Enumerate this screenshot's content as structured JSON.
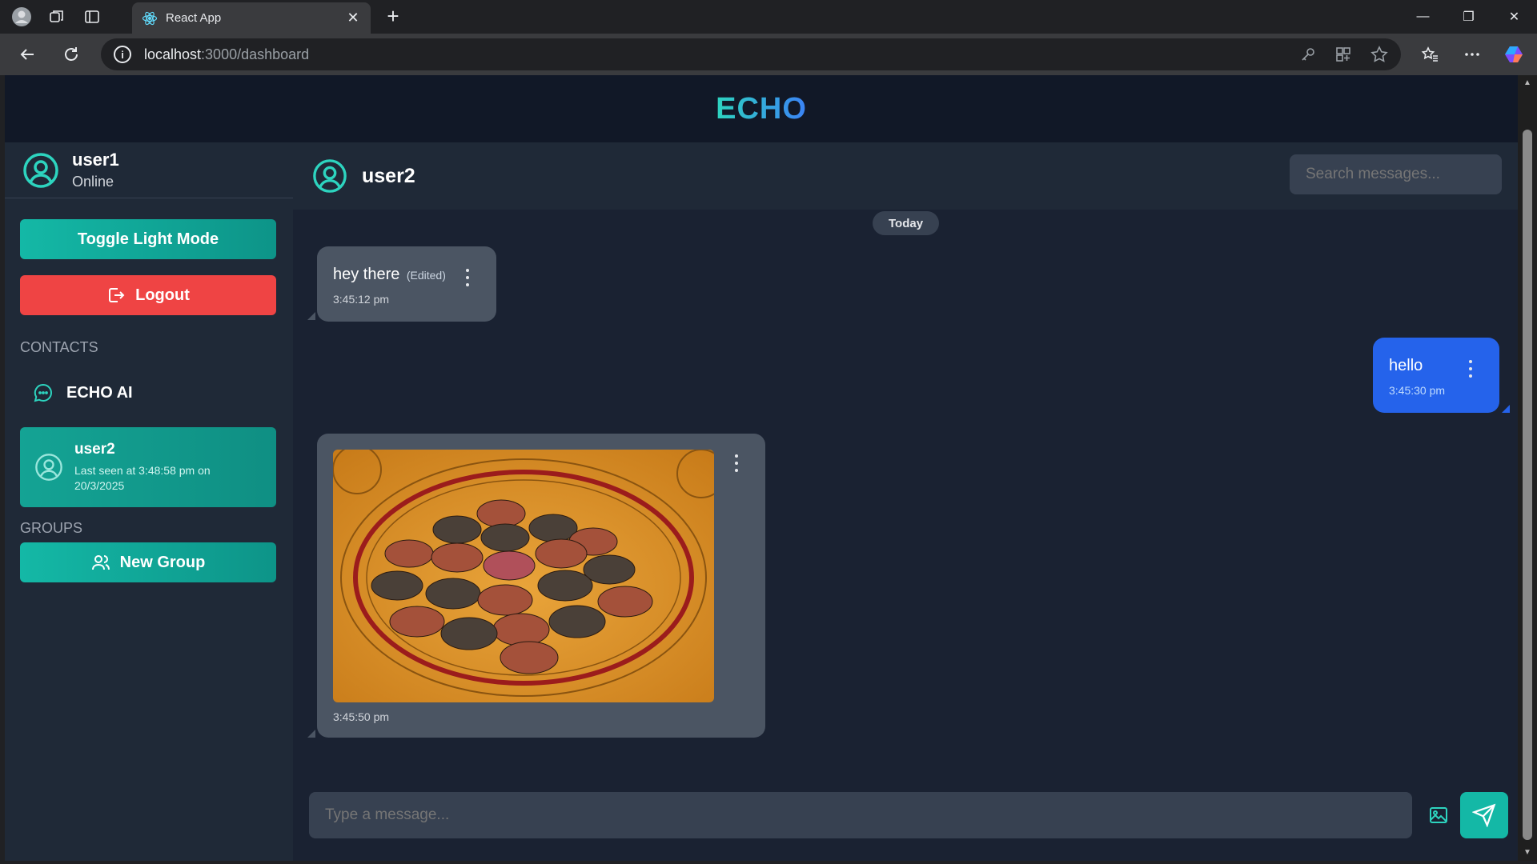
{
  "browser": {
    "tab_title": "React App",
    "tab_close": "✕",
    "new_tab": "+",
    "url_host": "localhost",
    "url_path": ":3000/dashboard",
    "info_icon_label": "i",
    "win_minimize": "—",
    "win_restore": "❐",
    "win_close": "✕"
  },
  "app": {
    "title": "ECHO"
  },
  "sidebar": {
    "user_name": "user1",
    "user_status": "Online",
    "toggle_label": "Toggle Light Mode",
    "logout_label": "Logout",
    "contacts_heading": "CONTACTS",
    "contacts": [
      {
        "name": "ECHO AI"
      },
      {
        "name": "user2",
        "last_seen": "Last seen at 3:48:58 pm on 20/3/2025"
      }
    ],
    "groups_heading": "GROUPS",
    "new_group_label": "New Group"
  },
  "chat": {
    "contact_name": "user2",
    "search_placeholder": "Search messages...",
    "date_divider": "Today",
    "messages": [
      {
        "direction": "in",
        "text": "hey there",
        "edited": "(Edited)",
        "time": "3:45:12 pm"
      },
      {
        "direction": "out",
        "text": "hello",
        "time": "3:45:30 pm"
      },
      {
        "direction": "in",
        "type": "image",
        "time": "3:45:50 pm"
      }
    ],
    "composer_placeholder": "Type a message..."
  },
  "colors": {
    "accent": "#14b8a6",
    "danger": "#ef4444",
    "outgoing": "#2563eb",
    "incoming": "#4b5563",
    "background": "#111827"
  }
}
